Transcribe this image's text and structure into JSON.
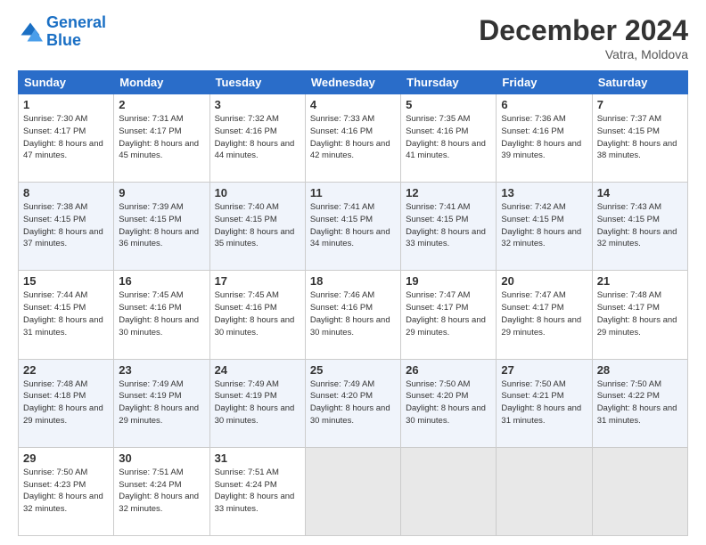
{
  "header": {
    "logo_line1": "General",
    "logo_line2": "Blue",
    "month": "December 2024",
    "location": "Vatra, Moldova"
  },
  "days_of_week": [
    "Sunday",
    "Monday",
    "Tuesday",
    "Wednesday",
    "Thursday",
    "Friday",
    "Saturday"
  ],
  "weeks": [
    [
      {
        "num": "1",
        "rise": "7:30 AM",
        "set": "4:17 PM",
        "daylight": "8 hours and 47 minutes."
      },
      {
        "num": "2",
        "rise": "7:31 AM",
        "set": "4:17 PM",
        "daylight": "8 hours and 45 minutes."
      },
      {
        "num": "3",
        "rise": "7:32 AM",
        "set": "4:16 PM",
        "daylight": "8 hours and 44 minutes."
      },
      {
        "num": "4",
        "rise": "7:33 AM",
        "set": "4:16 PM",
        "daylight": "8 hours and 42 minutes."
      },
      {
        "num": "5",
        "rise": "7:35 AM",
        "set": "4:16 PM",
        "daylight": "8 hours and 41 minutes."
      },
      {
        "num": "6",
        "rise": "7:36 AM",
        "set": "4:16 PM",
        "daylight": "8 hours and 39 minutes."
      },
      {
        "num": "7",
        "rise": "7:37 AM",
        "set": "4:15 PM",
        "daylight": "8 hours and 38 minutes."
      }
    ],
    [
      {
        "num": "8",
        "rise": "7:38 AM",
        "set": "4:15 PM",
        "daylight": "8 hours and 37 minutes."
      },
      {
        "num": "9",
        "rise": "7:39 AM",
        "set": "4:15 PM",
        "daylight": "8 hours and 36 minutes."
      },
      {
        "num": "10",
        "rise": "7:40 AM",
        "set": "4:15 PM",
        "daylight": "8 hours and 35 minutes."
      },
      {
        "num": "11",
        "rise": "7:41 AM",
        "set": "4:15 PM",
        "daylight": "8 hours and 34 minutes."
      },
      {
        "num": "12",
        "rise": "7:41 AM",
        "set": "4:15 PM",
        "daylight": "8 hours and 33 minutes."
      },
      {
        "num": "13",
        "rise": "7:42 AM",
        "set": "4:15 PM",
        "daylight": "8 hours and 32 minutes."
      },
      {
        "num": "14",
        "rise": "7:43 AM",
        "set": "4:15 PM",
        "daylight": "8 hours and 32 minutes."
      }
    ],
    [
      {
        "num": "15",
        "rise": "7:44 AM",
        "set": "4:15 PM",
        "daylight": "8 hours and 31 minutes."
      },
      {
        "num": "16",
        "rise": "7:45 AM",
        "set": "4:16 PM",
        "daylight": "8 hours and 30 minutes."
      },
      {
        "num": "17",
        "rise": "7:45 AM",
        "set": "4:16 PM",
        "daylight": "8 hours and 30 minutes."
      },
      {
        "num": "18",
        "rise": "7:46 AM",
        "set": "4:16 PM",
        "daylight": "8 hours and 30 minutes."
      },
      {
        "num": "19",
        "rise": "7:47 AM",
        "set": "4:17 PM",
        "daylight": "8 hours and 29 minutes."
      },
      {
        "num": "20",
        "rise": "7:47 AM",
        "set": "4:17 PM",
        "daylight": "8 hours and 29 minutes."
      },
      {
        "num": "21",
        "rise": "7:48 AM",
        "set": "4:17 PM",
        "daylight": "8 hours and 29 minutes."
      }
    ],
    [
      {
        "num": "22",
        "rise": "7:48 AM",
        "set": "4:18 PM",
        "daylight": "8 hours and 29 minutes."
      },
      {
        "num": "23",
        "rise": "7:49 AM",
        "set": "4:19 PM",
        "daylight": "8 hours and 29 minutes."
      },
      {
        "num": "24",
        "rise": "7:49 AM",
        "set": "4:19 PM",
        "daylight": "8 hours and 30 minutes."
      },
      {
        "num": "25",
        "rise": "7:49 AM",
        "set": "4:20 PM",
        "daylight": "8 hours and 30 minutes."
      },
      {
        "num": "26",
        "rise": "7:50 AM",
        "set": "4:20 PM",
        "daylight": "8 hours and 30 minutes."
      },
      {
        "num": "27",
        "rise": "7:50 AM",
        "set": "4:21 PM",
        "daylight": "8 hours and 31 minutes."
      },
      {
        "num": "28",
        "rise": "7:50 AM",
        "set": "4:22 PM",
        "daylight": "8 hours and 31 minutes."
      }
    ],
    [
      {
        "num": "29",
        "rise": "7:50 AM",
        "set": "4:23 PM",
        "daylight": "8 hours and 32 minutes."
      },
      {
        "num": "30",
        "rise": "7:51 AM",
        "set": "4:24 PM",
        "daylight": "8 hours and 32 minutes."
      },
      {
        "num": "31",
        "rise": "7:51 AM",
        "set": "4:24 PM",
        "daylight": "8 hours and 33 minutes."
      },
      null,
      null,
      null,
      null
    ]
  ]
}
